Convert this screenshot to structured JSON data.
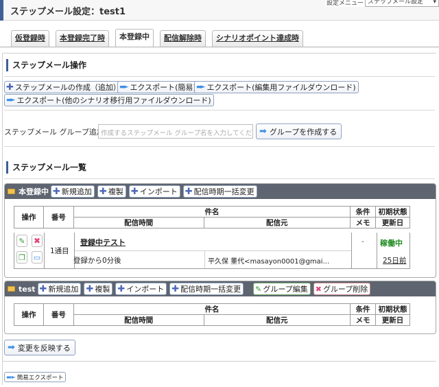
{
  "header": {
    "title": "ステップメール設定：test1",
    "setting_menu_label": "設定メニュー",
    "setting_menu_value": "ステップメール設定"
  },
  "tabs": [
    {
      "label": "仮登録時",
      "active": false
    },
    {
      "label": "本登録完了時",
      "active": false
    },
    {
      "label": "本登録中",
      "active": true
    },
    {
      "label": "配信解除時",
      "active": false
    },
    {
      "label": "シナリオポイント達成時",
      "active": false
    }
  ],
  "operations": {
    "title": "ステップメール操作",
    "create": "ステップメールの作成（追加）",
    "export_simple": "エクスポート(簡易)",
    "export_edit": "エクスポート(編集用ファイルダウンロード)",
    "export_other": "エクスポート(他のシナリオ移行用ファイルダウンロード)"
  },
  "group_add": {
    "label": "ステップメール グループ追加",
    "placeholder": "作成するステップメール グループ名を入力してくだ",
    "button": "グループを作成する"
  },
  "list": {
    "title": "ステップメール一覧",
    "headers": {
      "ops": "操作",
      "number": "番号",
      "subject": "件名",
      "send_time": "配信時間",
      "sender": "配信元",
      "condition": "条件",
      "memo": "メモ",
      "initial_state": "初期状態",
      "updated": "更新日"
    }
  },
  "groups": [
    {
      "name": "本登録中",
      "buttons": {
        "add": "新規追加",
        "copy": "複製",
        "import": "インポート",
        "bulk": "配信時期一括変更"
      },
      "rows": [
        {
          "number": "1通目",
          "subject": "登録中テスト",
          "send_time": "登録から0分後",
          "sender": "平久保 董代<masayon0001@gmai...",
          "condition": "-",
          "state": "稼働中",
          "updated": "25日前"
        }
      ]
    },
    {
      "name": "test",
      "buttons": {
        "add": "新規追加",
        "copy": "複製",
        "import": "インポート",
        "bulk": "配信時期一括変更",
        "edit": "グループ編集",
        "delete": "グループ削除"
      },
      "rows": []
    }
  ],
  "apply_button": "変更を反映する",
  "simple_export": "簡易エクスポート",
  "colors": {
    "accent": "#3f5f96",
    "group_header": "#5e6570",
    "state_active": "#1f8a1f",
    "plus": "#4d67b8"
  }
}
